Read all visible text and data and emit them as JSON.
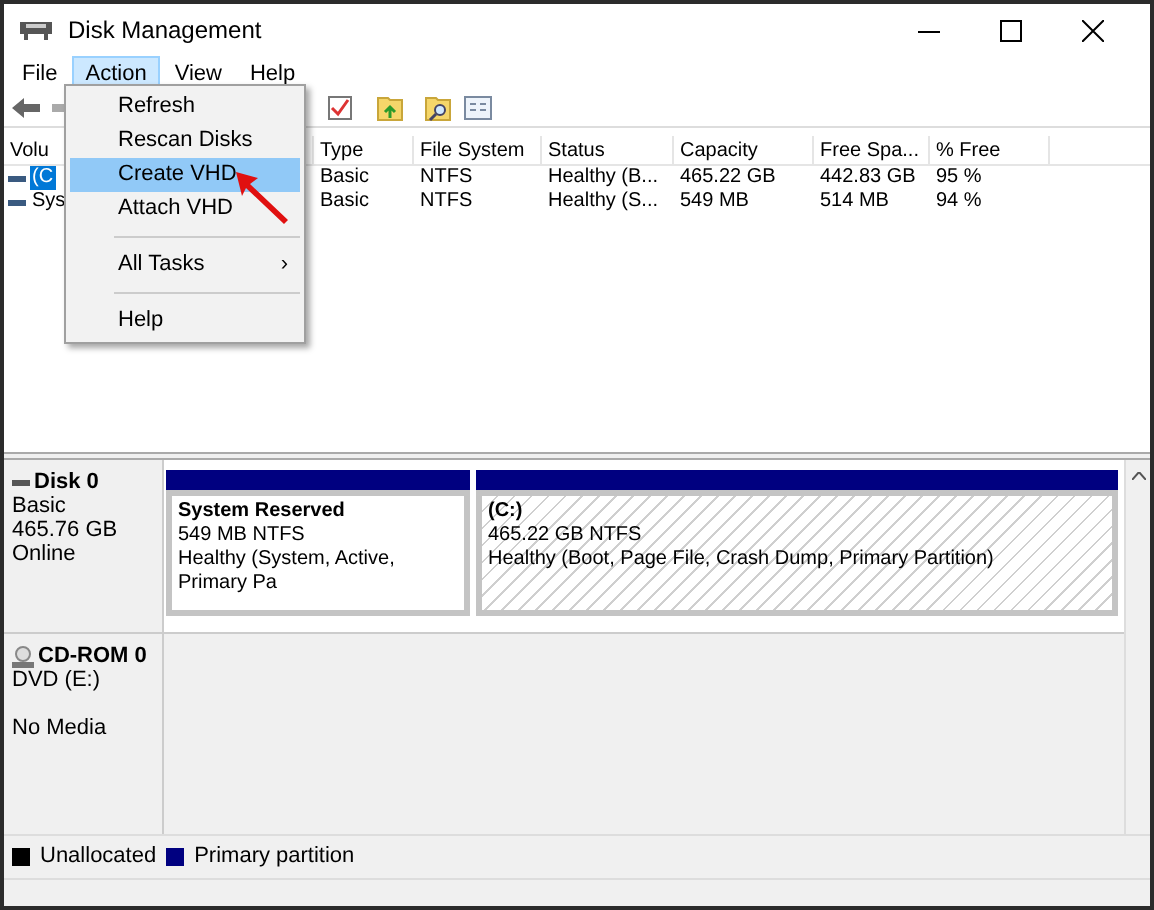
{
  "window": {
    "title": "Disk Management"
  },
  "menu_bar": [
    {
      "label": "File",
      "selected": false
    },
    {
      "label": "Action",
      "selected": true
    },
    {
      "label": "View",
      "selected": false
    },
    {
      "label": "Help",
      "selected": false
    }
  ],
  "action_menu": [
    {
      "kind": "item",
      "label": "Refresh",
      "selected": false
    },
    {
      "kind": "item",
      "label": "Rescan Disks",
      "selected": false
    },
    {
      "kind": "item",
      "label": "Create VHD",
      "selected": true
    },
    {
      "kind": "item",
      "label": "Attach VHD",
      "selected": false
    },
    {
      "kind": "separator"
    },
    {
      "kind": "submenu",
      "label": "All Tasks",
      "arrow": "›",
      "selected": false
    },
    {
      "kind": "separator"
    },
    {
      "kind": "item",
      "label": "Help",
      "selected": false
    }
  ],
  "volume_table": {
    "columns": [
      "Volu",
      "Type",
      "File System",
      "Status",
      "Capacity",
      "Free Spa...",
      "% Free"
    ],
    "rows": [
      {
        "selected": true,
        "cells": [
          "(C",
          "Basic",
          "NTFS",
          "Healthy (B...",
          "465.22 GB",
          "442.83 GB",
          "95 %"
        ]
      },
      {
        "selected": false,
        "cells": [
          "Sys",
          "Basic",
          "NTFS",
          "Healthy (S...",
          "549 MB",
          "514 MB",
          "94 %"
        ]
      }
    ]
  },
  "disks": [
    {
      "kind": "disk",
      "name": "Disk 0",
      "lines": [
        "Basic",
        "465.76 GB",
        "Online"
      ],
      "partitions": [
        {
          "name": "System Reserved",
          "size": "549 MB NTFS",
          "status": "Healthy (System, Active, Primary Pa",
          "hatched": false
        },
        {
          "name": "(C:)",
          "size": "465.22 GB NTFS",
          "status": "Healthy (Boot, Page File, Crash Dump, Primary Partition)",
          "hatched": true
        }
      ]
    },
    {
      "kind": "cdrom",
      "name": "CD-ROM 0",
      "lines": [
        "DVD (E:)"
      ],
      "media": "No Media"
    }
  ],
  "legend": [
    {
      "label": "Unallocated",
      "color": "#000000"
    },
    {
      "label": "Primary partition",
      "color": "#000080"
    }
  ]
}
